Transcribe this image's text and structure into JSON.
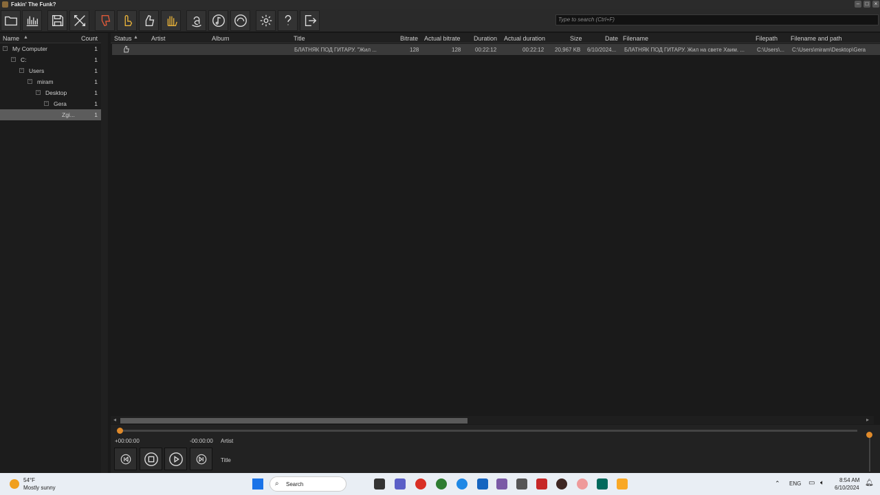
{
  "window": {
    "title": "Fakin' The Funk?"
  },
  "toolbar": {
    "buttons": [
      "folder-open-icon",
      "analyze-chart-icon",
      "save-icon",
      "clear-icon",
      "thumbs-down-icon",
      "hand-point-icon",
      "thumbs-up-icon",
      "hand-stop-icon",
      "amazon-icon",
      "music-note-icon",
      "spotify-like-icon",
      "settings-icon",
      "help-icon",
      "exit-icon"
    ]
  },
  "search": {
    "placeholder": "Type to search (Ctrl+F)"
  },
  "tree": {
    "headers": {
      "name": "Name",
      "count": "Count"
    },
    "items": [
      {
        "label": "My Computer",
        "count": "1",
        "toggle": "−"
      },
      {
        "label": "C:",
        "count": "1",
        "toggle": "−"
      },
      {
        "label": "Users",
        "count": "1",
        "toggle": "−"
      },
      {
        "label": "miram",
        "count": "1",
        "toggle": "−"
      },
      {
        "label": "Desktop",
        "count": "1",
        "toggle": "−"
      },
      {
        "label": "Gera",
        "count": "1",
        "toggle": "−"
      },
      {
        "label": "Zgi...",
        "count": "1",
        "toggle": ""
      }
    ]
  },
  "grid": {
    "headers": {
      "status": "Status",
      "artist": "Artist",
      "album": "Album",
      "title": "Title",
      "bitrate": "Bitrate",
      "actual_bitrate": "Actual bitrate",
      "duration": "Duration",
      "actual_duration": "Actual duration",
      "size": "Size",
      "date": "Date",
      "filename": "Filename",
      "filepath": "Filepath",
      "filename_path": "Filename and path"
    },
    "rows": [
      {
        "title": "БЛАТНЯК ПОД ГИТАРУ. \"Жил ...",
        "bitrate": "128",
        "actual_bitrate": "128",
        "duration": "00:22:12",
        "actual_duration": "00:22:12",
        "size": "20,967 KB",
        "date": "6/10/2024...",
        "filename": "БЛАТНЯК ПОД ГИТАРУ. Жил на свете Хаим. ...",
        "filepath": "C:\\Users\\...",
        "filename_path": "C:\\Users\\miram\\Desktop\\Gera"
      }
    ]
  },
  "player": {
    "elapsed": "+00:00:00",
    "remaining": "-00:00:00",
    "artist_label": "Artist",
    "title_label": "Title",
    "progress": 0
  },
  "taskbar": {
    "weather_temp": "54°F",
    "weather_desc": "Mostly sunny",
    "search": "Search",
    "lang": "ENG",
    "time": "8:54 AM",
    "date": "6/10/2024"
  }
}
